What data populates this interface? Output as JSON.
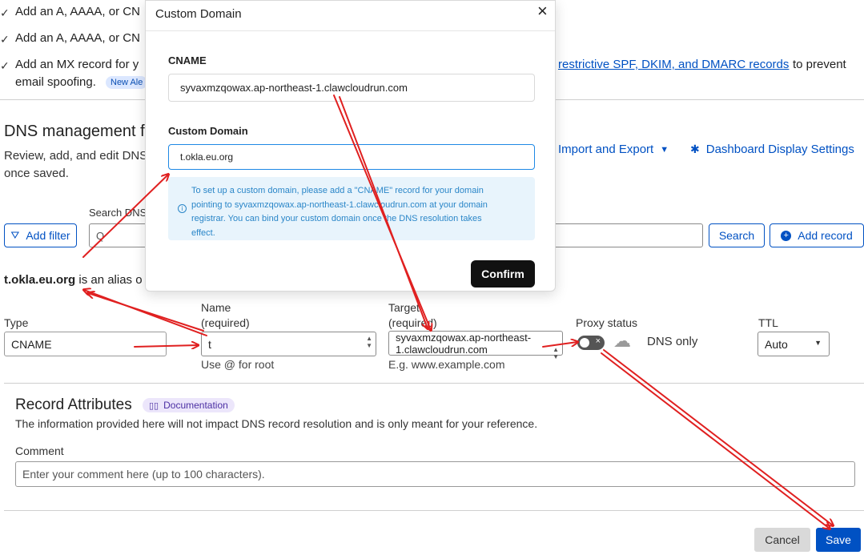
{
  "checklist": [
    {
      "text": "Add an A, AAAA, or CN"
    },
    {
      "text": "Add an A, AAAA, or CN"
    },
    {
      "text_start": "Add an MX record for y",
      "link": "restrictive SPF, DKIM, and DMARC records",
      "text_end": "to prevent",
      "line2": "email spoofing.",
      "badge": "New Ale"
    }
  ],
  "dns_section": {
    "title": "DNS management fo",
    "desc_line1": "Review, add, and edit DNS",
    "desc_line2": "once saved.",
    "import_export": "Import and Export",
    "dashboard_settings": "Dashboard Display Settings"
  },
  "toolbar": {
    "search_label": "Search DNS",
    "add_filter": "Add filter",
    "search_button": "Search",
    "add_record": "Add record"
  },
  "alias_notice": {
    "domain": "t.okla.eu.org",
    "text": "is an alias o"
  },
  "record_form": {
    "type_label": "Type",
    "type_value": "CNAME",
    "name_label": "Name",
    "name_req": "(required)",
    "name_value": "t",
    "name_hint": "Use @ for root",
    "target_label": "Target",
    "target_req": "(required)",
    "target_value_l1": "syvaxmzqowax.ap-northeast-",
    "target_value_l2": "1.clawcloudrun.com",
    "target_hint": "E.g. www.example.com",
    "proxy_label": "Proxy status",
    "proxy_value": "DNS only",
    "ttl_label": "TTL",
    "ttl_value": "Auto"
  },
  "attributes": {
    "title": "Record Attributes",
    "doc_badge": "Documentation",
    "desc": "The information provided here will not impact DNS record resolution and is only meant for your reference.",
    "comment_label": "Comment",
    "comment_placeholder": "Enter your comment here (up to 100 characters)."
  },
  "footer": {
    "cancel": "Cancel",
    "save": "Save"
  },
  "modal": {
    "title": "Custom Domain",
    "cname_label": "CNAME",
    "cname_value": "syvaxmzqowax.ap-northeast-1.clawcloudrun.com",
    "custom_label": "Custom Domain",
    "custom_value": "t.okla.eu.org",
    "info_l1": "To set up a custom domain, please add a \"CNAME\" record for your domain",
    "info_l2": "pointing to syvaxmzqowax.ap-northeast-1.clawcloudrun.com at your domain",
    "info_l3": "registrar. You can bind your custom domain once the DNS resolution takes",
    "info_l4": "effect.",
    "confirm": "Confirm"
  },
  "colors": {
    "accent": "#0051c3",
    "annotation_red": "#e02020"
  }
}
